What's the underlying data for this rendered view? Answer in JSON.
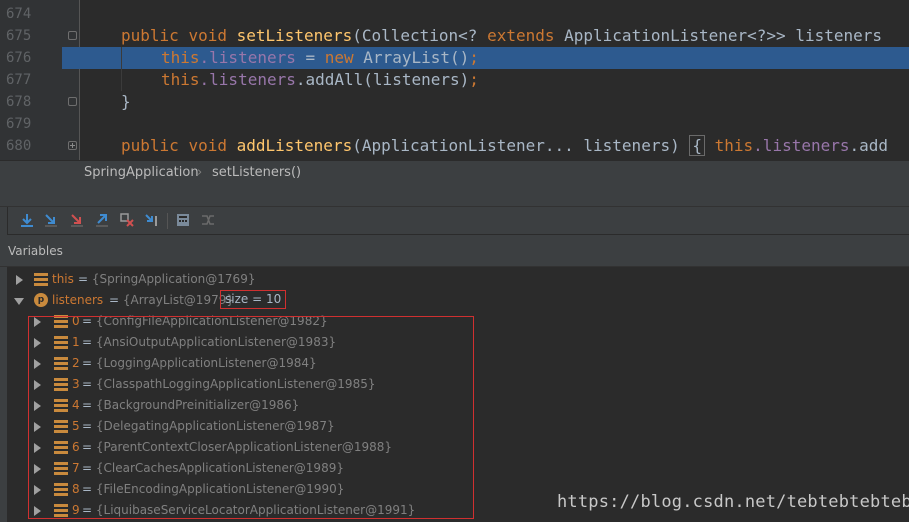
{
  "editor": {
    "lines": [
      {
        "num": "674",
        "kind": "plain",
        "text": ""
      },
      {
        "num": "675",
        "kind": "sig1"
      },
      {
        "num": "676",
        "kind": "body1"
      },
      {
        "num": "677",
        "kind": "body2"
      },
      {
        "num": "678",
        "kind": "close"
      },
      {
        "num": "679",
        "kind": "plain",
        "text": ""
      },
      {
        "num": "680",
        "kind": "sig2"
      }
    ],
    "sig1": {
      "kw1": "public",
      "kw2": "void",
      "fn": "setListeners",
      "params1": "(Collection<? ",
      "kw3": "extends",
      "params2": " ApplicationListener<?>> listeners"
    },
    "body1": {
      "this": "this",
      "dotfield": ".listeners",
      "eq": " = ",
      "kw": "new",
      "rest": " ArrayList()",
      "semi": ";"
    },
    "body2": {
      "this": "this",
      "dotfield": ".listeners",
      "rest": ".addAll(listeners)",
      "semi": ";"
    },
    "close": {
      "text": "}"
    },
    "sig2": {
      "kw1": "public",
      "kw2": "void",
      "fn": "addListeners",
      "params": "(ApplicationListener... listeners) ",
      "brace": "{",
      "this": " this",
      "dotfield": ".listeners",
      "rest": ".add"
    }
  },
  "breadcrumb": {
    "class_name": "SpringApplication",
    "method_name": "setListeners()"
  },
  "variables_panel": {
    "title": "Variables"
  },
  "variables": {
    "this_var": {
      "name": "this",
      "eq": " = ",
      "value": "{SpringApplication@1769}"
    },
    "listeners_var": {
      "icon_letter": "p",
      "name": "listeners",
      "eq": " = ",
      "value": "{ArrayList@1979}",
      "size": "size = 10"
    },
    "items": [
      {
        "index": "0",
        "value": "{ConfigFileApplicationListener@1982}"
      },
      {
        "index": "1",
        "value": "{AnsiOutputApplicationListener@1983}"
      },
      {
        "index": "2",
        "value": "{LoggingApplicationListener@1984}"
      },
      {
        "index": "3",
        "value": "{ClasspathLoggingApplicationListener@1985}"
      },
      {
        "index": "4",
        "value": "{BackgroundPreinitializer@1986}"
      },
      {
        "index": "5",
        "value": "{DelegatingApplicationListener@1987}"
      },
      {
        "index": "6",
        "value": "{ParentContextCloserApplicationListener@1988}"
      },
      {
        "index": "7",
        "value": "{ClearCachesApplicationListener@1989}"
      },
      {
        "index": "8",
        "value": "{FileEncodingApplicationListener@1990}"
      },
      {
        "index": "9",
        "value": "{LiquibaseServiceLocatorApplicationListener@1991}"
      }
    ]
  },
  "watermark": "https://blog.csdn.net/tebtebtebteb",
  "colors": {
    "keyword": "#cc7832",
    "method": "#ffc66d",
    "field": "#9876aa",
    "text": "#a9b7c6",
    "highlight": "#2d5a8f",
    "annotation": "#d03030"
  },
  "icons": [
    "step-over-icon",
    "step-into-icon",
    "force-step-into-icon",
    "step-out-icon",
    "drop-frame-icon",
    "run-to-cursor-icon",
    "evaluate-icon",
    "trace-icon"
  ]
}
